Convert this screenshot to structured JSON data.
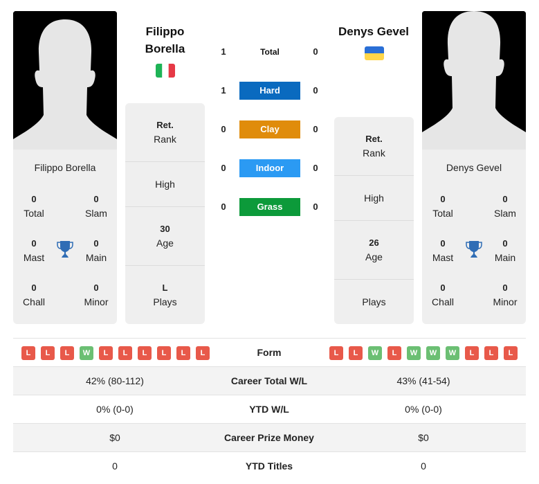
{
  "player_left": {
    "name_line1": "Filippo",
    "name_line2": "Borella",
    "full_name": "Filippo Borella",
    "country": "Italy",
    "flag_colors": [
      "#1eb356",
      "#ffffff",
      "#e63946"
    ],
    "titles": {
      "total": {
        "value": "0",
        "label": "Total"
      },
      "slam": {
        "value": "0",
        "label": "Slam"
      },
      "mast": {
        "value": "0",
        "label": "Mast"
      },
      "main": {
        "value": "0",
        "label": "Main"
      },
      "chall": {
        "value": "0",
        "label": "Chall"
      },
      "minor": {
        "value": "0",
        "label": "Minor"
      }
    },
    "info": {
      "rank": {
        "value": "Ret.",
        "label": "Rank"
      },
      "high": {
        "value": "",
        "label": "High"
      },
      "age": {
        "value": "30",
        "label": "Age"
      },
      "plays": {
        "value": "L",
        "label": "Plays"
      }
    },
    "form": [
      "L",
      "L",
      "L",
      "W",
      "L",
      "L",
      "L",
      "L",
      "L",
      "L"
    ]
  },
  "player_right": {
    "name": "Denys Gevel",
    "full_name": "Denys Gevel",
    "country": "Ukraine",
    "flag_colors": [
      "#2a6fd6",
      "#ffd64a"
    ],
    "titles": {
      "total": {
        "value": "0",
        "label": "Total"
      },
      "slam": {
        "value": "0",
        "label": "Slam"
      },
      "mast": {
        "value": "0",
        "label": "Mast"
      },
      "main": {
        "value": "0",
        "label": "Main"
      },
      "chall": {
        "value": "0",
        "label": "Chall"
      },
      "minor": {
        "value": "0",
        "label": "Minor"
      }
    },
    "info": {
      "rank": {
        "value": "Ret.",
        "label": "Rank"
      },
      "high": {
        "value": "",
        "label": "High"
      },
      "age": {
        "value": "26",
        "label": "Age"
      },
      "plays": {
        "value": "",
        "label": "Plays"
      }
    },
    "form": [
      "L",
      "L",
      "W",
      "L",
      "W",
      "W",
      "W",
      "L",
      "L",
      "L"
    ]
  },
  "h2h": [
    {
      "label": "Total",
      "left": "1",
      "right": "0",
      "color": null
    },
    {
      "label": "Hard",
      "left": "1",
      "right": "0",
      "color": "#0a6abf"
    },
    {
      "label": "Clay",
      "left": "0",
      "right": "0",
      "color": "#e08c0b"
    },
    {
      "label": "Indoor",
      "left": "0",
      "right": "0",
      "color": "#2b9af3"
    },
    {
      "label": "Grass",
      "left": "0",
      "right": "0",
      "color": "#0c9a3a"
    }
  ],
  "form_label": "Form",
  "comparison": [
    {
      "label": "Career Total W/L",
      "left": "42% (80-112)",
      "right": "43% (41-54)"
    },
    {
      "label": "YTD W/L",
      "left": "0% (0-0)",
      "right": "0% (0-0)"
    },
    {
      "label": "Career Prize Money",
      "left": "$0",
      "right": "$0"
    },
    {
      "label": "YTD Titles",
      "left": "0",
      "right": "0"
    }
  ],
  "colors": {
    "loss": "#e8594a",
    "win": "#6bbf73",
    "trophy": "#2f6db5",
    "card_bg": "#efefef"
  }
}
